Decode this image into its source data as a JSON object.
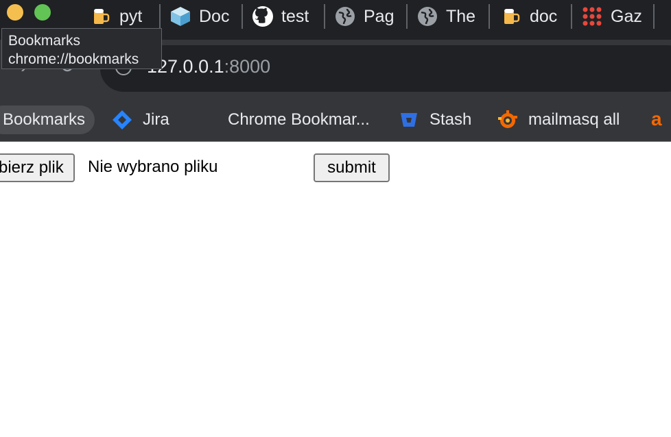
{
  "tabs": [
    {
      "title": "pyt",
      "icon": "beer-mug-icon"
    },
    {
      "title": "Doc",
      "icon": "cube-icon"
    },
    {
      "title": "test",
      "icon": "github-icon"
    },
    {
      "title": "Pag",
      "icon": "globe-icon"
    },
    {
      "title": "The",
      "icon": "globe-icon"
    },
    {
      "title": "doc",
      "icon": "beer-mug-icon"
    },
    {
      "title": "Gaz",
      "icon": "dots-grid-icon"
    }
  ],
  "tooltip": {
    "title": "Bookmarks",
    "url": "chrome://bookmarks"
  },
  "omnibox": {
    "host": "127.0.0.1",
    "port": ":8000"
  },
  "bookmarks": [
    {
      "label": "Bookmarks",
      "icon": ""
    },
    {
      "label": "Jira",
      "icon": "jira-icon"
    },
    {
      "label": "Chrome Bookmar...",
      "icon": ""
    },
    {
      "label": "Stash",
      "icon": "bitbucket-icon"
    },
    {
      "label": "mailmasq all",
      "icon": "grafana-icon"
    },
    {
      "label": "",
      "icon": "amazon-icon"
    }
  ],
  "form": {
    "file_button_label": "bierz plik",
    "file_status": "Nie wybrano pliku",
    "submit_label": "submit"
  },
  "colors": {
    "chrome_dark": "#202124",
    "chrome_toolbar": "#35363a",
    "traffic_yellow": "#f5bf4f",
    "traffic_green": "#61c454",
    "jira_blue": "#2684ff",
    "stash_blue": "#2f6fe4",
    "grafana_orange": "#f46800"
  }
}
